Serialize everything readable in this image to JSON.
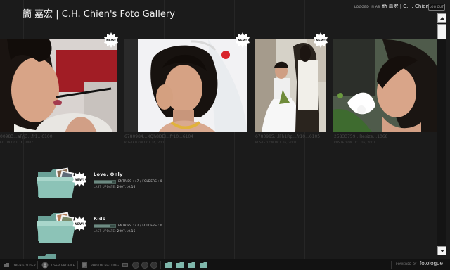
{
  "site": {
    "title": "簡 嘉宏 | C.H. Chien's Foto Gallery"
  },
  "session": {
    "logged_in_prefix": "LOGGED IN AS",
    "user": "簡 嘉宏 | C.H. Chien",
    "logout_label": "LOG OUT"
  },
  "badge_label": "NEW!",
  "photos": [
    {
      "filename": "00983...aF/j3...fr1...6100",
      "posted": "ED ON OCT 16, 2007"
    },
    {
      "filename": "6780984...XQh8DEI...fr10...6104",
      "posted": "POSTED ON OCT 16, 2007"
    },
    {
      "filename": "6780985...lFh1Rp...fr10...6105",
      "posted": "POSTED ON OCT 16, 2007"
    },
    {
      "filename": "25833759...Resize...1068",
      "posted": "POSTED ON OCT 16, 2007"
    }
  ],
  "albums": [
    {
      "title": "Love, Only",
      "stats": "ENTRIES : 47  /  FOLDERS : 0",
      "update_label": "LAST UPDATE:",
      "update_value": "2007.10.16",
      "fill": 0.85
    },
    {
      "title": "Kids",
      "stats": "ENTRIES : 42  /  FOLDERS : 0",
      "update_label": "LAST UPDATE:",
      "update_value": "2007.10.16",
      "fill": 0.75
    }
  ],
  "toolbar": {
    "open_folder": "OPEN FOLDER",
    "user_profile": "USER PROFILE",
    "photochat": "PHOTOCHATTING",
    "powered_by": "POWERED BY",
    "brand": "fotologue"
  },
  "colors": {
    "background": "#1b1b1b",
    "folder_teal": "#7fb7ab",
    "badge": "#ffffff"
  },
  "icons": [
    "new-badge-icon",
    "folder-icon",
    "open-folder-icon",
    "user-profile-icon",
    "photochat-icon",
    "scroll-up-arrow",
    "scroll-down-arrow"
  ]
}
